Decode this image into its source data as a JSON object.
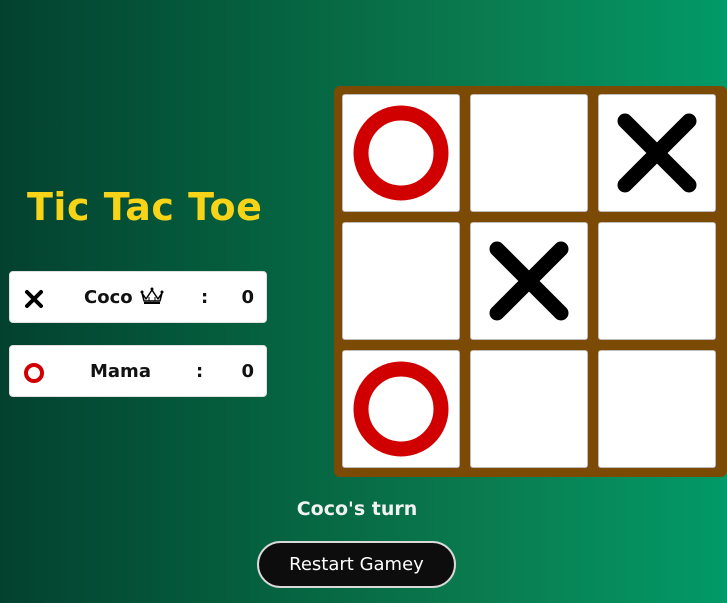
{
  "title": "Tic Tac Toe",
  "players": [
    {
      "mark": "X",
      "name": "Coco",
      "separator": ":",
      "score": "0",
      "crown_icon": "crown-icon"
    },
    {
      "mark": "O",
      "name": "Mama",
      "separator": ":",
      "score": "0"
    }
  ],
  "board": [
    "O",
    "",
    "X",
    "",
    "X",
    "",
    "O",
    "",
    ""
  ],
  "status": "Coco's turn",
  "restart_label": "Restart Gamey",
  "colors": {
    "title": "#f7d418",
    "x_mark": "#000000",
    "o_mark": "#d10000",
    "board_frame": "#7b4a04",
    "background_start": "#03412f",
    "background_end": "#029a68"
  }
}
